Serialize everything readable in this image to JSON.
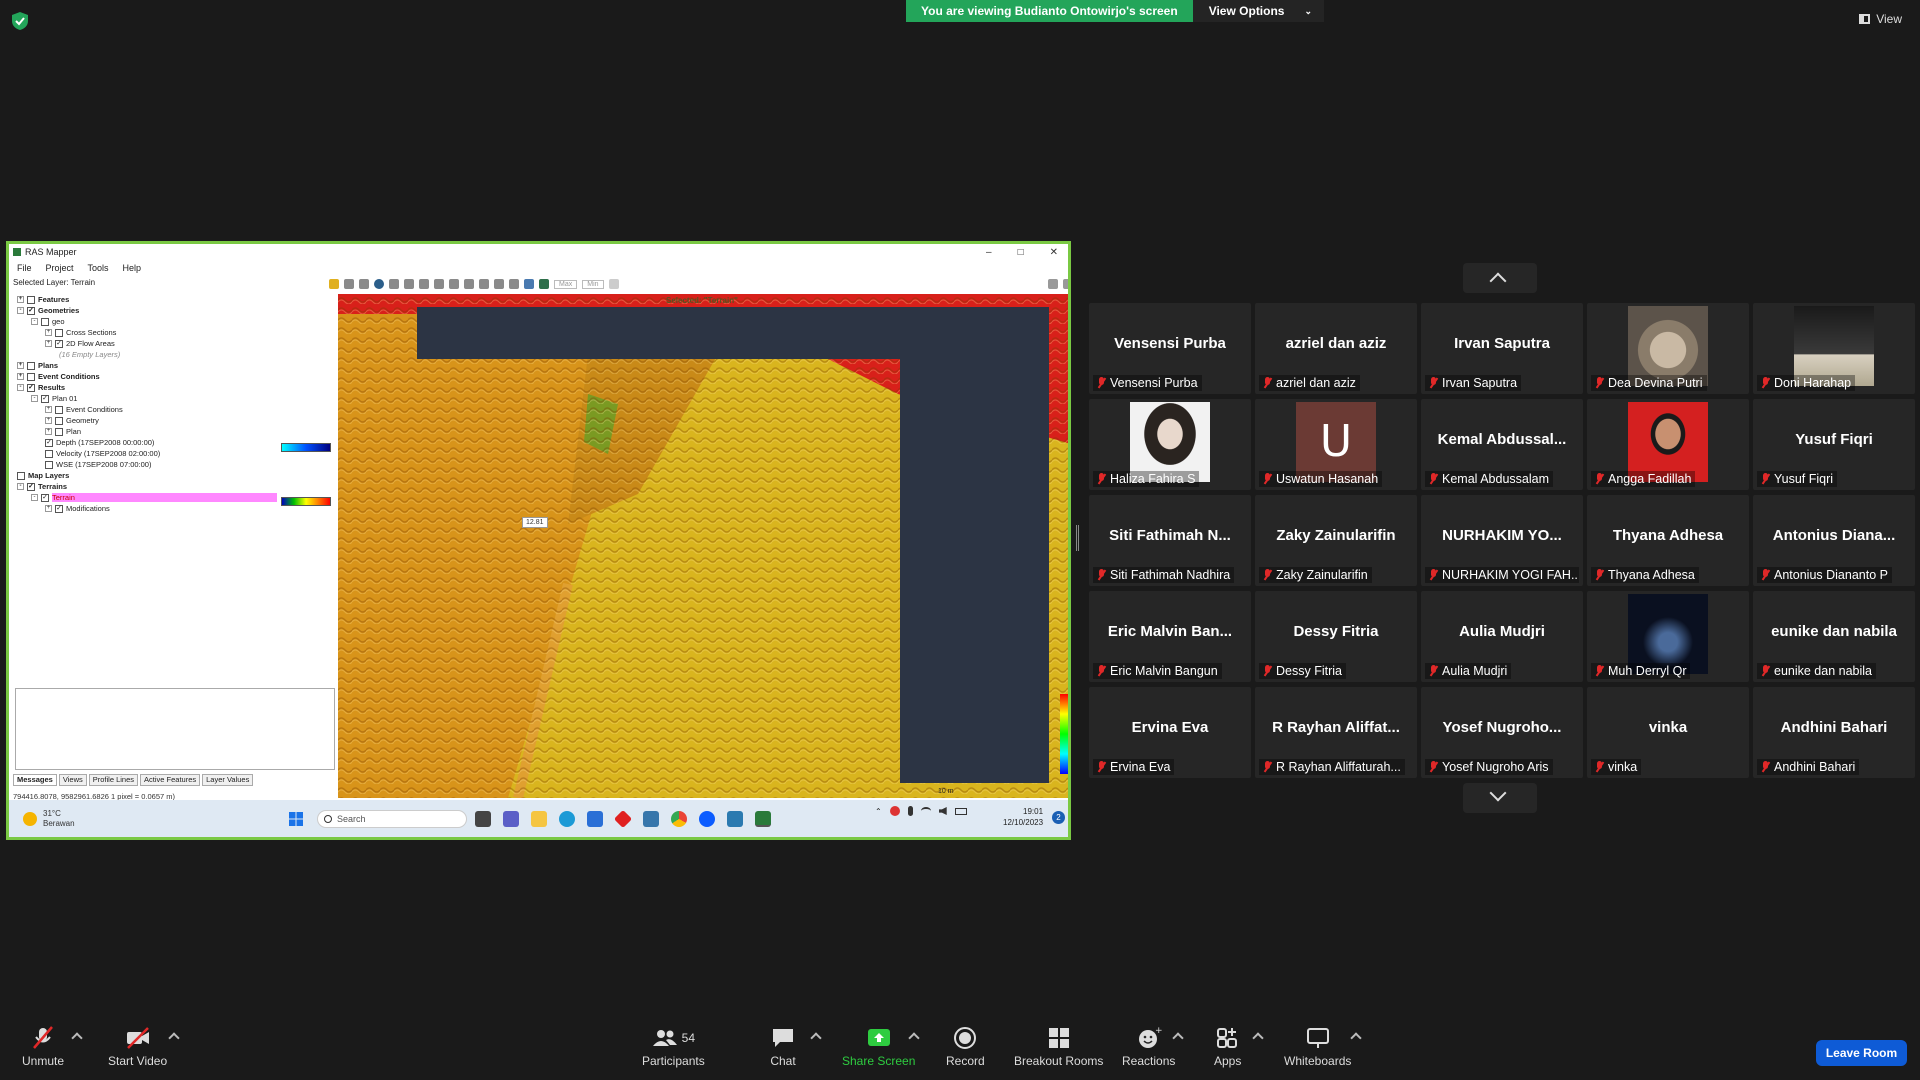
{
  "banner": {
    "viewing": "You are viewing Budianto Ontowirjo's screen",
    "view_options": "View Options"
  },
  "view_top": "View",
  "ras": {
    "title": "RAS Mapper",
    "menu": [
      "File",
      "Project",
      "Tools",
      "Help"
    ],
    "selected_layer": "Selected Layer: Terrain",
    "toolbar_max": "Max",
    "toolbar_min": "Min",
    "tree": [
      {
        "label": "Features",
        "bold": true
      },
      {
        "label": "Geometries",
        "bold": true,
        "checked": true
      },
      {
        "label": "geo"
      },
      {
        "label": "Cross Sections"
      },
      {
        "label": "2D Flow Areas",
        "checked": true
      },
      {
        "label": "(16 Empty Layers)"
      },
      {
        "label": "Plans",
        "bold": true
      },
      {
        "label": "Event Conditions",
        "bold": true
      },
      {
        "label": "Results",
        "bold": true,
        "checked": true
      },
      {
        "label": "Plan 01",
        "checked": true
      },
      {
        "label": "Event Conditions"
      },
      {
        "label": "Geometry"
      },
      {
        "label": "Plan"
      },
      {
        "label": "Depth (17SEP2008 00:00:00)",
        "checked": true
      },
      {
        "label": "Velocity (17SEP2008 02:00:00)"
      },
      {
        "label": "WSE (17SEP2008 07:00:00)"
      },
      {
        "label": "Map Layers",
        "bold": true
      },
      {
        "label": "Terrains",
        "bold": true,
        "checked": true
      },
      {
        "label": "Terrain",
        "checked": true
      },
      {
        "label": "Modifications",
        "checked": true
      }
    ],
    "tabs": [
      "Messages",
      "Views",
      "Profile Lines",
      "Active Features",
      "Layer Values"
    ],
    "status": "794416.8078, 9582961.6826  1 pixel = 0.0657 m)",
    "map_selected": "Selected: \"Terrain\"",
    "tooltip": "12.81",
    "scale": "10 m"
  },
  "windows": {
    "weather_temp": "31°C",
    "weather_desc": "Berawan",
    "search": "Search",
    "time": "19:01",
    "date": "12/10/2023",
    "notif": "2"
  },
  "participants": [
    {
      "big": "Vensensi Purba",
      "label": "Vensensi Purba"
    },
    {
      "big": "azriel dan aziz",
      "label": "azriel dan aziz"
    },
    {
      "big": "Irvan Saputra",
      "label": "Irvan Saputra"
    },
    {
      "photo": "cat",
      "label": "Dea Devina Putri"
    },
    {
      "photo": "dark",
      "label": "Doni Harahap"
    },
    {
      "photo": "girl",
      "label": "Haliza Fahira S"
    },
    {
      "avatar": "U",
      "label": "Uswatun Hasanah"
    },
    {
      "big": "Kemal  Abdussal...",
      "label": "Kemal Abdussalam"
    },
    {
      "photo": "red",
      "label": "Angga Fadillah"
    },
    {
      "big": "Yusuf Fiqri",
      "label": "Yusuf Fiqri"
    },
    {
      "big": "Siti  Fathimah  N...",
      "label": "Siti Fathimah Nadhira"
    },
    {
      "big": "Zaky Zainularifin",
      "label": "Zaky Zainularifin"
    },
    {
      "big": "NURHAKIM  YO...",
      "label": "NURHAKIM YOGI FAH..."
    },
    {
      "big": "Thyana Adhesa",
      "label": "Thyana Adhesa"
    },
    {
      "big": "Antonius  Diana...",
      "label": "Antonius Dianantо P"
    },
    {
      "big": "Eric  Malvin  Ban...",
      "label": "Eric Malvin Bangun"
    },
    {
      "big": "Dessy Fitria",
      "label": "Dessy Fitria"
    },
    {
      "big": "Aulia Mudjri",
      "label": "Aulia Mudjri"
    },
    {
      "photo": "night",
      "label": "Muh Derryl Qr"
    },
    {
      "big": "eunike dan nabila",
      "label": "eunike dan nabila"
    },
    {
      "big": "Ervina Eva",
      "label": "Ervina Eva"
    },
    {
      "big": "R  Rayhan  Aliffat...",
      "label": "R Rayhan Aliffaturah..."
    },
    {
      "big": "Yosef  Nugroho...",
      "label": "Yosef Nugroho Aris"
    },
    {
      "big": "vinka",
      "label": "vinka"
    },
    {
      "big": "Andhini Bahari",
      "label": "Andhini Bahari"
    }
  ],
  "toolbar": {
    "unmute": "Unmute",
    "start_video": "Start Video",
    "participants_count": "54",
    "participants": "Participants",
    "chat": "Chat",
    "share_screen": "Share Screen",
    "record": "Record",
    "breakout": "Breakout Rooms",
    "reactions": "Reactions",
    "apps": "Apps",
    "whiteboards": "Whiteboards",
    "leave": "Leave Room"
  },
  "colors": {
    "banner_green": "#23a55a",
    "share_green": "#2ecc40",
    "leave_blue": "#0e5bd6",
    "mute_red": "#e02828"
  }
}
